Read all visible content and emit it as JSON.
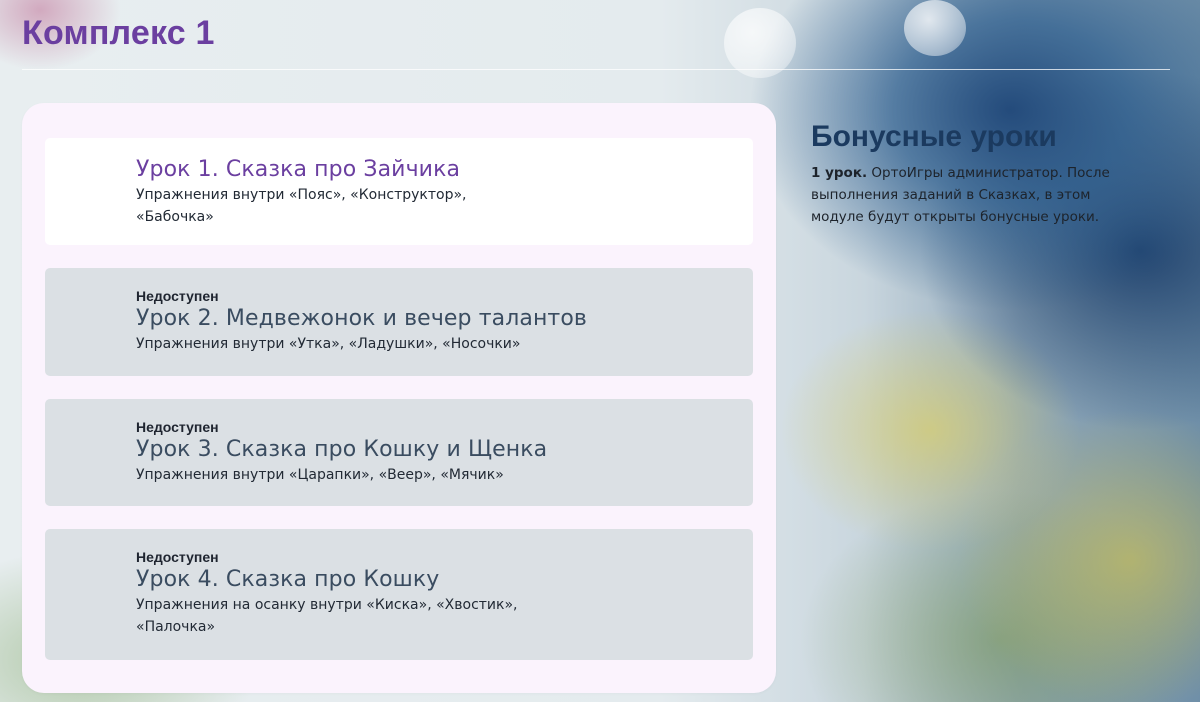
{
  "page": {
    "title": "Комплекс 1"
  },
  "lessons": [
    {
      "status": "",
      "title": "Урок 1. Сказка про Зайчика",
      "description": "Упражнения внутри «Пояс», «Конструктор», «Бабочка»",
      "available": true
    },
    {
      "status": "Недоступен",
      "title": "Урок 2. Медвежонок и вечер талантов",
      "description": "Упражнения внутри «Утка», «Ладушки», «Носочки»",
      "available": false
    },
    {
      "status": "Недоступен",
      "title": "Урок 3. Сказка про Кошку и Щенка",
      "description": "Упражнения внутри «Царапки», «Веер», «Мячик»",
      "available": false
    },
    {
      "status": "Недоступен",
      "title": "Урок 4. Сказка про Кошку",
      "description": "Упражнения на осанку внутри «Киска», «Хвостик», «Палочка»",
      "available": false
    }
  ],
  "bonus": {
    "title": "Бонусные уроки",
    "count_label": "1 урок.",
    "text": "ОртоИгры администратор. После выполнения заданий в Сказках, в этом модуле будут открыты бонусные уроки."
  },
  "colors": {
    "accent_purple": "#6b3fa0",
    "bonus_title_navy": "#1b3a5f",
    "locked_card_bg": "#dbe0e4",
    "panel_bg": "#fbf3fd"
  }
}
